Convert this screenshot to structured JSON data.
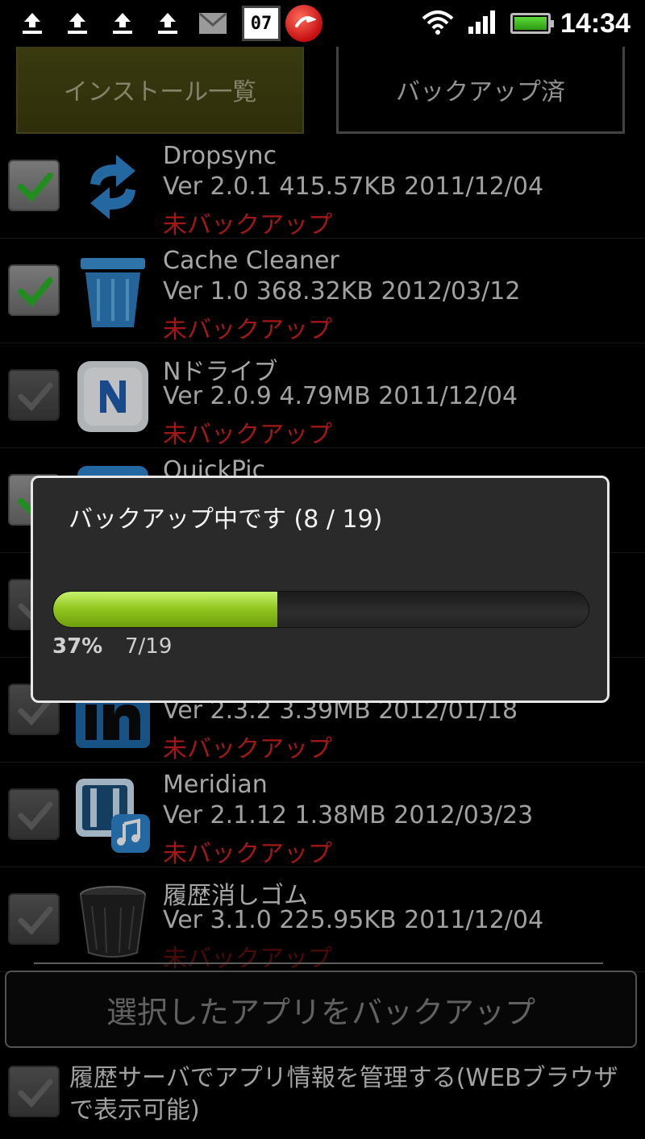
{
  "status_bar": {
    "calendar_day": "07",
    "time": "14:34",
    "icons": [
      "upload-icon",
      "upload-icon",
      "upload-icon",
      "upload-icon",
      "mail-icon",
      "calendar-icon",
      "trend-micro-icon",
      "wifi-icon",
      "signal-icon",
      "battery-icon"
    ]
  },
  "tabs": {
    "installed": "インストール一覧",
    "backed_up": "バックアップ済"
  },
  "apps": [
    {
      "name": "Dropsync",
      "meta": "Ver 2.0.1 415.57KB 2011/12/04",
      "status": "未バックアップ",
      "checked": true,
      "icon": "sync-arrows-icon"
    },
    {
      "name": "Cache Cleaner",
      "meta": "Ver 1.0 368.32KB 2012/03/12",
      "status": "未バックアップ",
      "checked": true,
      "icon": "trash-can-icon"
    },
    {
      "name": "Nドライブ",
      "meta": "Ver 2.0.9 4.79MB 2011/12/04",
      "status": "未バックアップ",
      "checked": false,
      "icon": "n-drive-icon"
    },
    {
      "name": "QuickPic",
      "meta": "",
      "status": "",
      "checked": true,
      "icon": "quickpic-icon"
    },
    {
      "name": "",
      "meta": "",
      "status": "",
      "checked": false,
      "icon": "app-icon"
    },
    {
      "name": "",
      "meta": "Ver 2.3.2 3.39MB 2012/01/18",
      "status": "未バックアップ",
      "checked": false,
      "icon": "linkedin-icon"
    },
    {
      "name": "Meridian",
      "meta": "Ver 2.1.12 1.38MB 2012/03/23",
      "status": "未バックアップ",
      "checked": false,
      "icon": "meridian-icon"
    },
    {
      "name": "履歴消しゴム",
      "meta": "Ver 3.1.0 225.95KB 2011/12/04",
      "status": "未バックアップ",
      "checked": false,
      "icon": "wastebasket-icon"
    }
  ],
  "dialog": {
    "title": "バックアップ中です (8 / 19)",
    "percent_label": "37%",
    "count_label": "7/19",
    "progress": 0.37
  },
  "main_button": "選択したアプリをバックアップ",
  "footer": {
    "label": "履歴サーバでアプリ情報を管理する(WEBブラウザで表示可能)",
    "checked": false
  },
  "colors": {
    "progress": "#8fc51c",
    "status_text": "#d01f1f",
    "active_tab": "#4a4a14"
  }
}
